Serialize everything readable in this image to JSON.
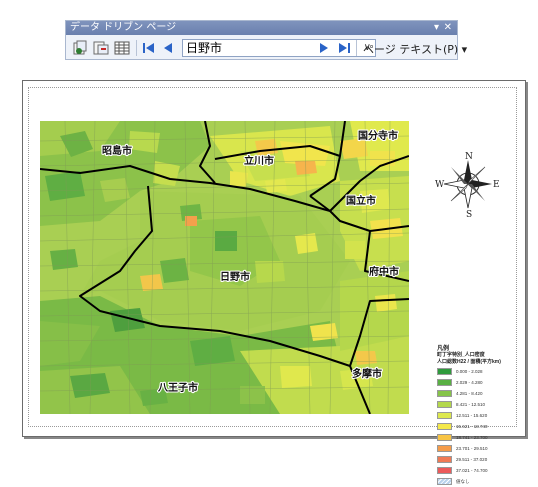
{
  "toolbar": {
    "title": "データ ドリブン ページ",
    "page_select_value": "日野市",
    "page_text_label": "ページ テキスト(P)",
    "buttons": [
      "refresh-pages",
      "setup-pages",
      "attribute-table",
      "first-page",
      "previous-page",
      "next-page",
      "last-page"
    ]
  },
  "map": {
    "city_labels": [
      "国分寺市",
      "昭島市",
      "立川市",
      "国立市",
      "府中市",
      "日野市",
      "多摩市",
      "八王子市"
    ]
  },
  "compass": {
    "n": "N",
    "s": "S",
    "e": "E",
    "w": "W"
  },
  "legend": {
    "title": "凡例",
    "field_line1": "町丁字特別_人口密度",
    "field_line2": "人口総数H22 / 面積(平方km)",
    "classes": [
      {
        "label": "0.000 - 2.028",
        "color": "#2f9a3d"
      },
      {
        "label": "2.029 - 4.280",
        "color": "#58b043"
      },
      {
        "label": "4.281 - 8.420",
        "color": "#86c449"
      },
      {
        "label": "8.421 - 12.510",
        "color": "#b4d84c"
      },
      {
        "label": "12.511 - 15.620",
        "color": "#dde84f"
      },
      {
        "label": "15.621 - 18.740",
        "color": "#f4e84a"
      },
      {
        "label": "18.741 - 23.700",
        "color": "#f8c444"
      },
      {
        "label": "23.701 - 29.510",
        "color": "#f59c4a"
      },
      {
        "label": "29.511 - 37.020",
        "color": "#f07a55"
      },
      {
        "label": "37.021 - 74.700",
        "color": "#ec5a5a"
      }
    ],
    "nodata_label": "値なし"
  }
}
